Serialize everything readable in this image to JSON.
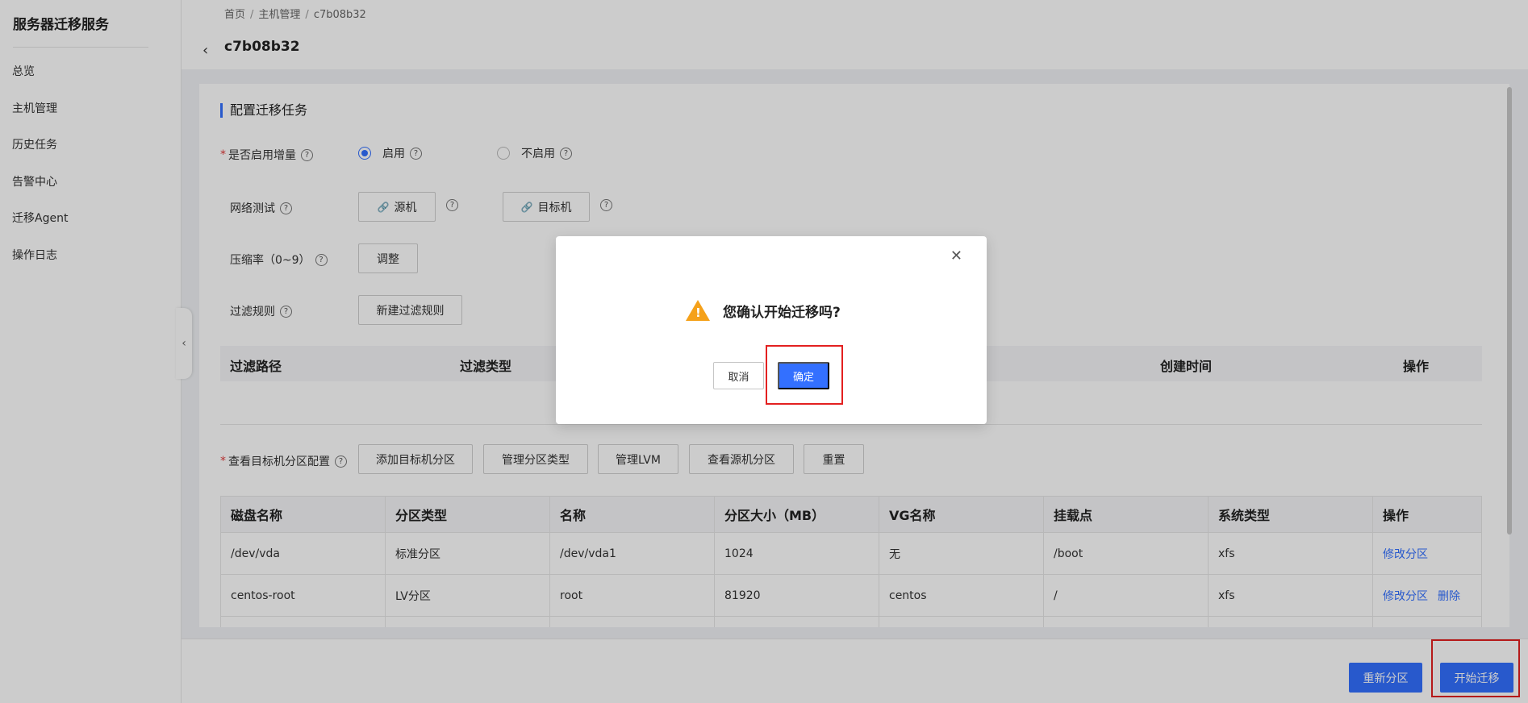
{
  "sidebar": {
    "title": "服务器迁移服务",
    "items": [
      {
        "label": "总览"
      },
      {
        "label": "主机管理"
      },
      {
        "label": "历史任务"
      },
      {
        "label": "告警中心"
      },
      {
        "label": "迁移Agent"
      },
      {
        "label": "操作日志"
      }
    ]
  },
  "header": {
    "breadcrumb": [
      "首页",
      "主机管理",
      "c7b08b32"
    ],
    "title": "c7b08b32"
  },
  "form": {
    "section_title": "配置迁移任务",
    "incremental_label": "是否启用增量",
    "enable_label": "启用",
    "disable_label": "不启用",
    "network_test_label": "网络测试",
    "source_btn": "源机",
    "target_btn": "目标机",
    "compress_label": "压缩率（0~9）",
    "adjust_btn": "调整",
    "filter_label": "过滤规则",
    "new_filter_btn": "新建过滤规则"
  },
  "filter_table": {
    "columns": [
      "过滤路径",
      "过滤类型",
      "创建时间",
      "操作"
    ]
  },
  "partition": {
    "label": "查看目标机分区配置",
    "buttons": [
      "添加目标机分区",
      "管理分区类型",
      "管理LVM",
      "查看源机分区",
      "重置"
    ],
    "columns": [
      "磁盘名称",
      "分区类型",
      "名称",
      "分区大小（MB）",
      "VG名称",
      "挂载点",
      "系统类型",
      "操作"
    ],
    "rows": [
      {
        "disk": "/dev/vda",
        "type": "标准分区",
        "name": "/dev/vda1",
        "size": "1024",
        "vg": "无",
        "mount": "/boot",
        "fs": "xfs",
        "actions": [
          "修改分区"
        ]
      },
      {
        "disk": "centos-root",
        "type": "LV分区",
        "name": "root",
        "size": "81920",
        "vg": "centos",
        "mount": "/",
        "fs": "xfs",
        "actions": [
          "修改分区",
          "删除"
        ]
      }
    ]
  },
  "footer": {
    "repartition_btn": "重新分区",
    "start_btn": "开始迁移"
  },
  "modal": {
    "message": "您确认开始迁移吗?",
    "cancel": "取消",
    "ok": "确定"
  },
  "colors": {
    "primary": "#3370ff",
    "highlight": "#e32020",
    "warning": "#f5a11a"
  }
}
